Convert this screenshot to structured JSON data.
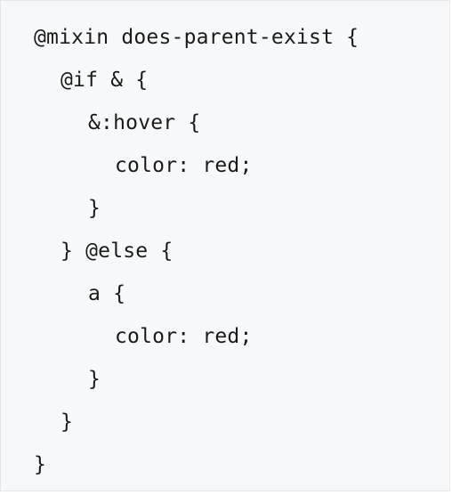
{
  "code": {
    "language": "SCSS",
    "lines": [
      {
        "text": "@mixin does-parent-exist {",
        "indent": 0
      },
      {
        "text": "@if & {",
        "indent": 1
      },
      {
        "text": "&:hover {",
        "indent": 2
      },
      {
        "text": "color: red;",
        "indent": 3
      },
      {
        "text": "}",
        "indent": 2
      },
      {
        "text": "} @else {",
        "indent": 1
      },
      {
        "text": "a {",
        "indent": 2
      },
      {
        "text": "color: red;",
        "indent": 3
      },
      {
        "text": "}",
        "indent": 2
      },
      {
        "text": "}",
        "indent": 1
      },
      {
        "text": "}",
        "indent": 0
      }
    ]
  },
  "colors": {
    "background": "#f6f8fa",
    "border": "#e3e6e9",
    "text": "#1b1b1b"
  }
}
